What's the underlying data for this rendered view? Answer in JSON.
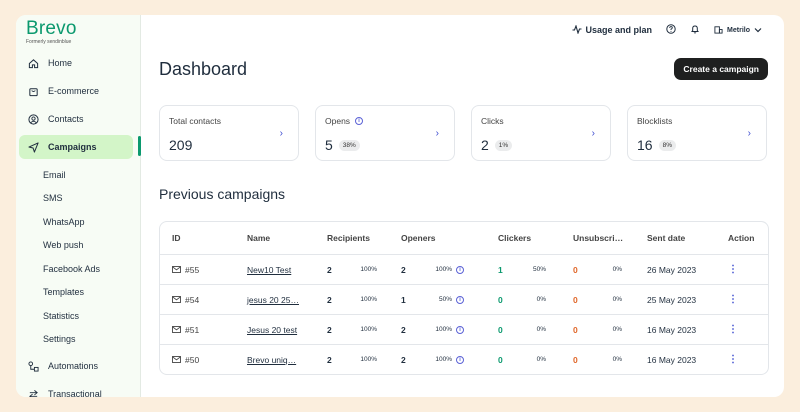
{
  "brand": {
    "name": "Brevo",
    "tagline": "Formerly sendinblue",
    "accent": "#0b996e"
  },
  "sidebar": {
    "items": [
      {
        "label": "Home",
        "icon": "home-icon"
      },
      {
        "label": "E-commerce",
        "icon": "bag-icon"
      },
      {
        "label": "Contacts",
        "icon": "contacts-icon"
      },
      {
        "label": "Campaigns",
        "icon": "send-icon",
        "active": true
      }
    ],
    "subitems": [
      "Email",
      "SMS",
      "WhatsApp",
      "Web push",
      "Facebook Ads",
      "Templates",
      "Statistics",
      "Settings"
    ],
    "bottom": [
      {
        "label": "Automations",
        "icon": "automation-icon"
      },
      {
        "label": "Transactional",
        "icon": "transactional-icon"
      }
    ]
  },
  "topbar": {
    "usage_label": "Usage and plan",
    "org": "Metrilo"
  },
  "page": {
    "title": "Dashboard",
    "create_label": "Create a campaign",
    "section_title": "Previous campaigns"
  },
  "stats": [
    {
      "label": "Total contacts",
      "value": "209",
      "pct": "",
      "info": false
    },
    {
      "label": "Opens",
      "value": "5",
      "pct": "38%",
      "info": true
    },
    {
      "label": "Clicks",
      "value": "2",
      "pct": "1%",
      "info": false
    },
    {
      "label": "Blocklists",
      "value": "16",
      "pct": "8%",
      "info": false
    }
  ],
  "table": {
    "headers": {
      "id": "ID",
      "name": "Name",
      "recipients": "Recipients",
      "openers": "Openers",
      "clickers": "Clickers",
      "unsubscribers": "Unsubscri…",
      "sent_date": "Sent date",
      "action": "Action"
    },
    "rows": [
      {
        "id": "#55",
        "name": "New10 Test",
        "recipients": "2",
        "recipients_pct": "100%",
        "openers": "2",
        "openers_pct": "100%",
        "clickers": "1",
        "clickers_pct": "50%",
        "unsub": "0",
        "unsub_pct": "0%",
        "date": "26 May 2023"
      },
      {
        "id": "#54",
        "name": "jesus 20 25…",
        "recipients": "2",
        "recipients_pct": "100%",
        "openers": "1",
        "openers_pct": "50%",
        "clickers": "0",
        "clickers_pct": "0%",
        "unsub": "0",
        "unsub_pct": "0%",
        "date": "25 May 2023"
      },
      {
        "id": "#51",
        "name": "Jesus 20 test",
        "recipients": "2",
        "recipients_pct": "100%",
        "openers": "2",
        "openers_pct": "100%",
        "clickers": "0",
        "clickers_pct": "0%",
        "unsub": "0",
        "unsub_pct": "0%",
        "date": "16 May 2023"
      },
      {
        "id": "#50",
        "name": "Brevo uniq…",
        "recipients": "2",
        "recipients_pct": "100%",
        "openers": "2",
        "openers_pct": "100%",
        "clickers": "0",
        "clickers_pct": "0%",
        "unsub": "0",
        "unsub_pct": "0%",
        "date": "16 May 2023"
      }
    ]
  }
}
